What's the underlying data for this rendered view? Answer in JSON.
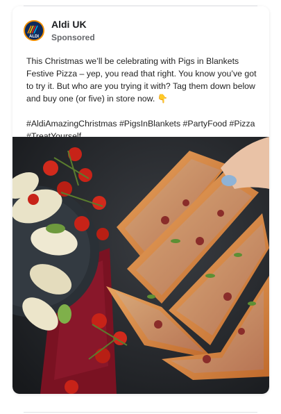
{
  "post": {
    "author": "Aldi UK",
    "label": "Sponsored",
    "avatar_icon": "aldi-logo-icon",
    "avatar_text": "ALDI",
    "body": "This Christmas we’ll be celebrating with Pigs in Blankets Festive Pizza – yep, you read that right. You know you’ve got to try it. But who are you trying it with? Tag them down below and buy one (or five) in store now. 👇",
    "hashtags": "#AldiAmazingChristmas #PigsInBlankets #PartyFood #Pizza #TreatYourself",
    "image_icon": "pizza-photo",
    "colors": {
      "brand_navy": "#0d2a5c",
      "brand_orange": "#f08d00",
      "text": "#222222",
      "muted": "#65676b"
    }
  }
}
